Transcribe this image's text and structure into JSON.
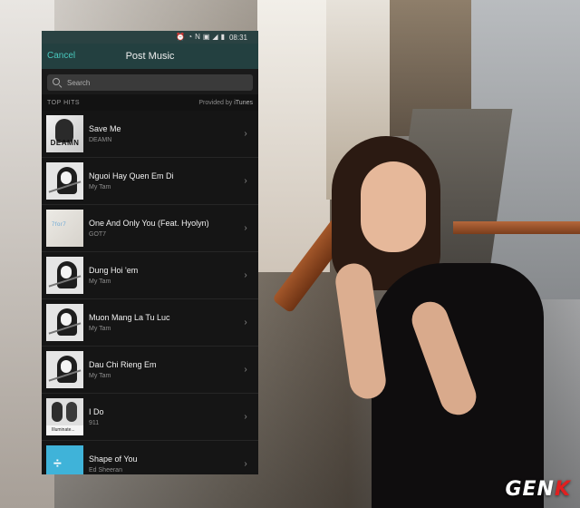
{
  "status_bar": {
    "time": "08:31",
    "icons": [
      "alarm-icon",
      "wifi-icon",
      "nfc-icon",
      "battery-saver-icon",
      "signal-icon",
      "battery-icon"
    ]
  },
  "header": {
    "cancel_label": "Cancel",
    "title": "Post Music"
  },
  "search": {
    "placeholder": "Search"
  },
  "section": {
    "title": "TOP HITS",
    "provider_prefix": "Provided by ",
    "provider_name": "iTunes"
  },
  "songs": [
    {
      "title": "Save Me",
      "artist": "DEAMN",
      "art_text": "DEAMN"
    },
    {
      "title": "Nguoi Hay Quen Em Di",
      "artist": "My Tam"
    },
    {
      "title": "One And Only You (Feat. Hyolyn)",
      "artist": "GOT7",
      "art_text": "7for7"
    },
    {
      "title": "Dung Hoi 'em",
      "artist": "My Tam"
    },
    {
      "title": "Muon Mang La Tu Luc",
      "artist": "My Tam"
    },
    {
      "title": "Dau Chi Rieng Em",
      "artist": "My Tam"
    },
    {
      "title": "I Do",
      "artist": "911",
      "art_text": "Illuminate..."
    },
    {
      "title": "Shape of You",
      "artist": "Ed Sheeran",
      "art_text": "÷"
    }
  ],
  "watermark": {
    "text_main": "GEN",
    "text_accent": "K"
  },
  "colors": {
    "accent": "#48c8bd",
    "header_bg": "#234040",
    "list_bg": "#151515"
  }
}
